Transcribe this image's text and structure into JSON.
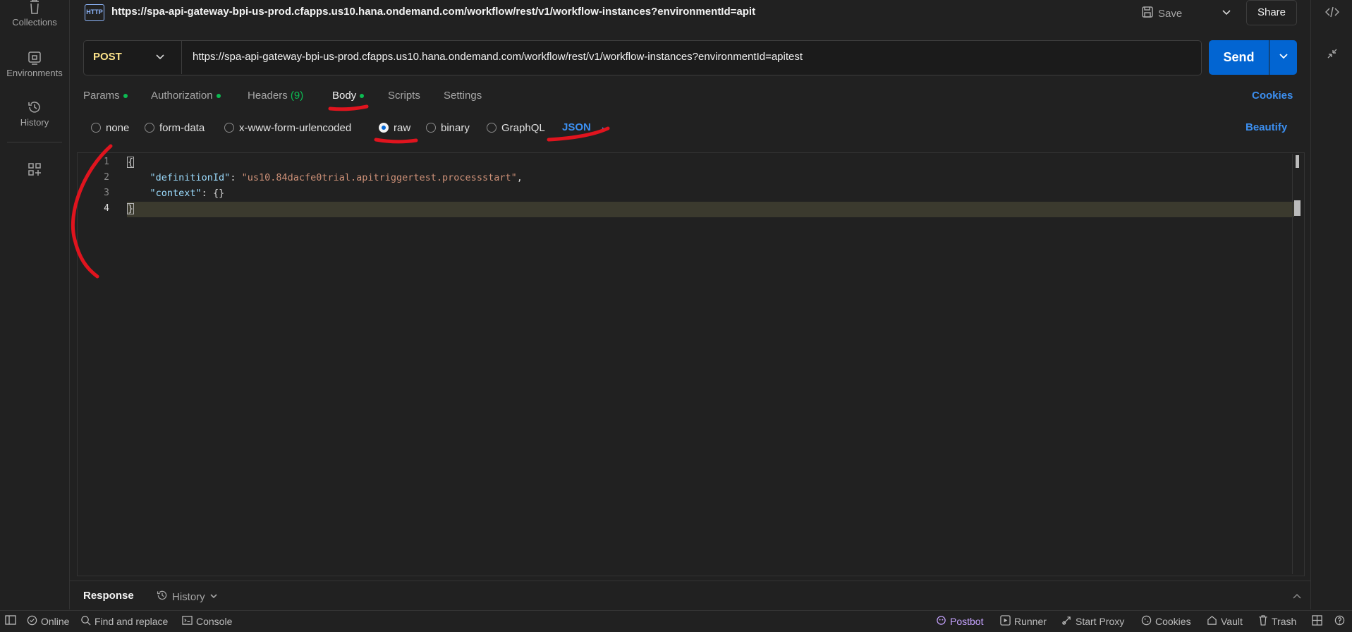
{
  "sidebar": {
    "items": [
      {
        "label": "Collections",
        "icon": "trash-icon"
      },
      {
        "label": "Environments",
        "icon": "environment-icon"
      },
      {
        "label": "History",
        "icon": "history-icon"
      },
      {
        "label": "",
        "icon": "add-widget-icon"
      }
    ]
  },
  "header": {
    "title": "https://spa-api-gateway-bpi-us-prod.cfapps.us10.hana.ondemand.com/workflow/rest/v1/workflow-instances?environmentId=apit",
    "http_badge": "HTTP",
    "save_label": "Save",
    "share_label": "Share"
  },
  "request": {
    "method": "POST",
    "url": "https://spa-api-gateway-bpi-us-prod.cfapps.us10.hana.ondemand.com/workflow/rest/v1/workflow-instances?environmentId=apitest",
    "send_label": "Send"
  },
  "tabs": {
    "params": "Params",
    "authorization": "Authorization",
    "headers": "Headers",
    "headers_count": "(9)",
    "body": "Body",
    "scripts": "Scripts",
    "settings": "Settings",
    "cookies": "Cookies"
  },
  "body_types": {
    "none": "none",
    "form_data": "form-data",
    "urlencoded": "x-www-form-urlencoded",
    "raw": "raw",
    "binary": "binary",
    "graphql": "GraphQL",
    "format": "JSON",
    "selected": "raw",
    "beautify": "Beautify"
  },
  "editor": {
    "line_numbers": [
      "1",
      "2",
      "3",
      "4"
    ],
    "open_brace": "{",
    "close_brace": "}",
    "key1": "\"definitionId\"",
    "val1": "\"us10.84dacfe0trial.apitriggertest.processstart\"",
    "key2": "\"context\"",
    "val2": "{}"
  },
  "response": {
    "label": "Response",
    "history_label": "History"
  },
  "statusbar": {
    "online": "Online",
    "find_replace": "Find and replace",
    "console": "Console",
    "postbot": "Postbot",
    "runner": "Runner",
    "start_proxy": "Start Proxy",
    "cookies": "Cookies",
    "vault": "Vault",
    "trash": "Trash"
  },
  "colors": {
    "accent": "#0265d2",
    "link": "#3c8ff0",
    "method": "#fce38a",
    "status_dot": "#0cbb52",
    "annotation": "#e0141e"
  }
}
